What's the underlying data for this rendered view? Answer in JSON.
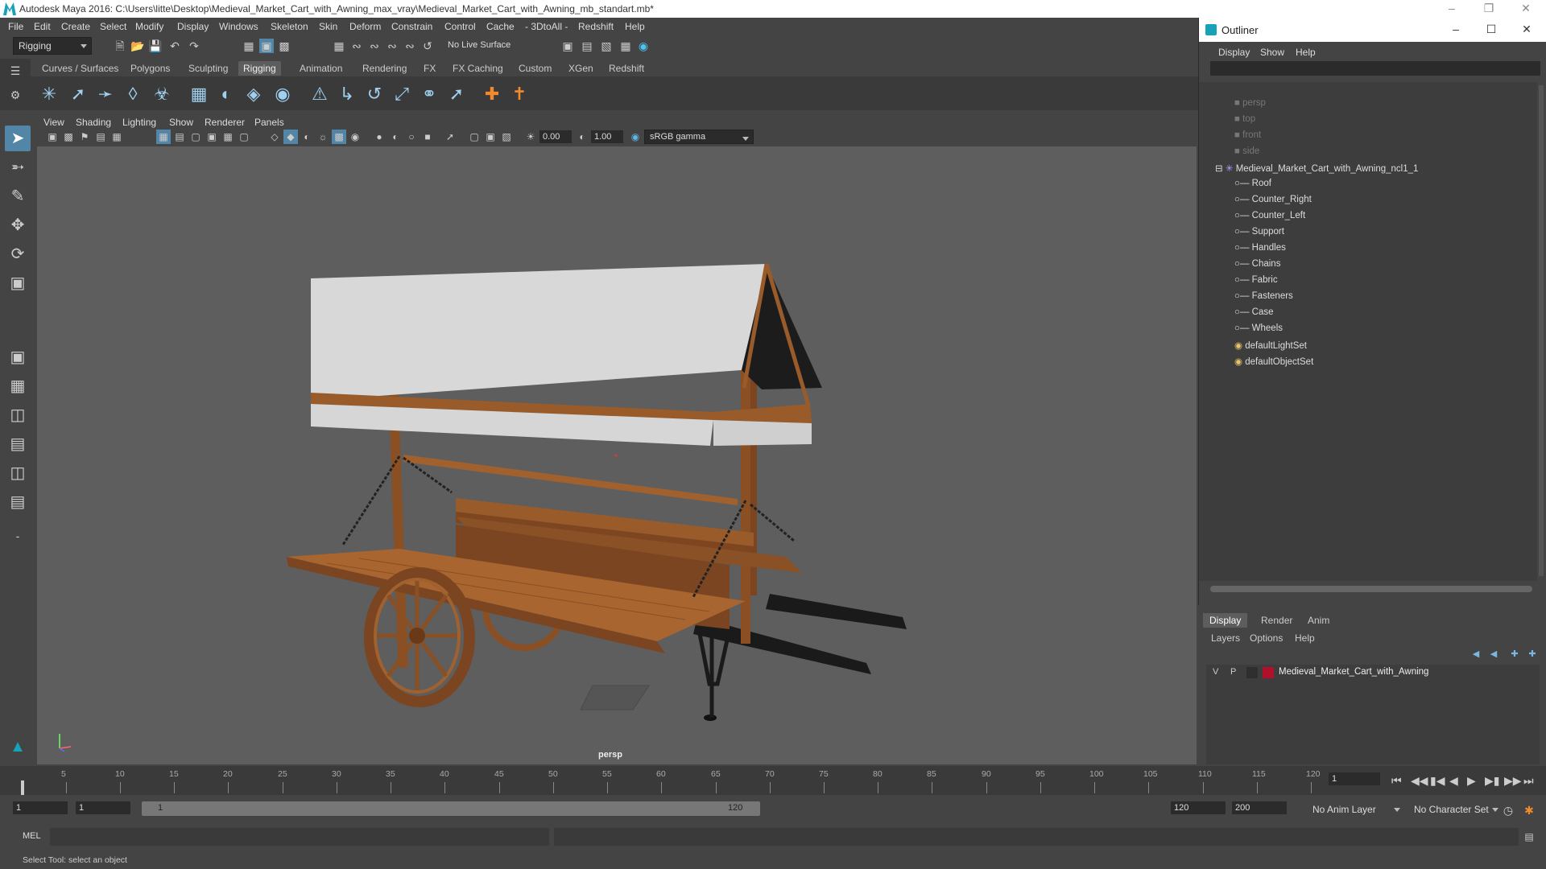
{
  "window": {
    "title": "Autodesk Maya 2016: C:\\Users\\litte\\Desktop\\Medieval_Market_Cart_with_Awning_max_vray\\Medieval_Market_Cart_with_Awning_mb_standart.mb*"
  },
  "menubar": [
    "File",
    "Edit",
    "Create",
    "Select",
    "Modify",
    "Display",
    "Windows",
    "Skeleton",
    "Skin",
    "Deform",
    "Constrain",
    "Control",
    "Cache",
    "- 3DtoAll -",
    "Redshift",
    "Help"
  ],
  "statusline": {
    "menuset": "Rigging",
    "live_surface": "No Live Surface"
  },
  "shelf": {
    "tabs": [
      "Curves / Surfaces",
      "Polygons",
      "Sculpting",
      "Rigging",
      "Animation",
      "Rendering",
      "FX",
      "FX Caching",
      "Custom",
      "XGen",
      "Redshift"
    ],
    "active_tab": "Rigging"
  },
  "panel": {
    "menus": [
      "View",
      "Shading",
      "Lighting",
      "Show",
      "Renderer",
      "Panels"
    ],
    "exposure": "0.00",
    "gamma": "1.00",
    "colorspace": "sRGB gamma",
    "camera_label": "persp"
  },
  "outliner": {
    "title": "Outliner",
    "menus": [
      "Display",
      "Show",
      "Help"
    ],
    "cameras": [
      "persp",
      "top",
      "front",
      "side"
    ],
    "root": "Medieval_Market_Cart_with_Awning_ncl1_1",
    "children": [
      "Roof",
      "Counter_Right",
      "Counter_Left",
      "Support",
      "Handles",
      "Chains",
      "Fabric",
      "Fasteners",
      "Case",
      "Wheels"
    ],
    "sets": [
      "defaultLightSet",
      "defaultObjectSet"
    ]
  },
  "layers": {
    "tabs": [
      "Display",
      "Render",
      "Anim"
    ],
    "active_tab": "Display",
    "menus": [
      "Layers",
      "Options",
      "Help"
    ],
    "rows": [
      {
        "v": "V",
        "p": "P",
        "name": "Medieval_Market_Cart_with_Awning",
        "color": "#b0102a"
      }
    ]
  },
  "timeline": {
    "ticks": [
      1,
      5,
      10,
      15,
      20,
      25,
      30,
      35,
      40,
      45,
      50,
      55,
      60,
      65,
      70,
      75,
      80,
      85,
      90,
      95,
      100,
      105,
      110,
      115,
      120
    ],
    "current_frame": "1"
  },
  "range": {
    "start": "1",
    "playback_start": "1",
    "slider_start": "1",
    "slider_end": "120",
    "playback_end": "120",
    "end": "200",
    "anim_layer": "No Anim Layer",
    "character_set": "No Character Set"
  },
  "cmdline": {
    "label": "MEL"
  },
  "helpline": {
    "text": "Select Tool: select an object"
  },
  "colors": {
    "accent": "#5285a6",
    "wood": "#a0612e",
    "cloth": "#d8d8d8",
    "layer_color": "#b0102a"
  }
}
